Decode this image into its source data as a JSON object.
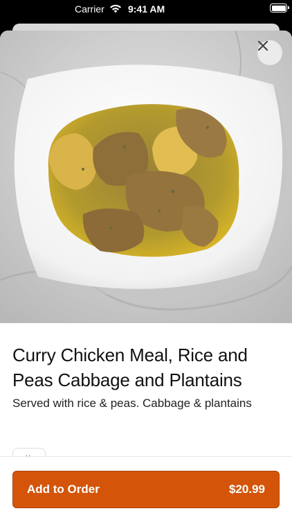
{
  "status_bar": {
    "carrier": "Carrier",
    "time": "9:41 AM"
  },
  "item": {
    "image_description": "curry-chicken-plate",
    "title": "Curry Chicken Meal, Rice and Peas Cabbage and Plantains",
    "description": "Served with rice & peas. Cabbage & plantains"
  },
  "footer": {
    "add_label": "Add to Order",
    "price": "$20.99"
  },
  "colors": {
    "accent": "#d4550a",
    "accent_border": "#a84206",
    "curry": "#c8a326"
  },
  "icons": {
    "close": "close-icon",
    "wifi": "wifi-icon",
    "battery": "battery-icon"
  }
}
